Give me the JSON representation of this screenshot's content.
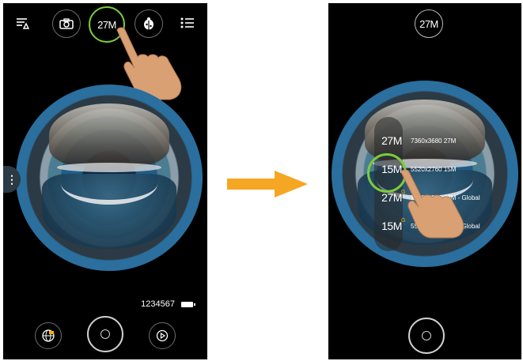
{
  "left_screen": {
    "top_icons": [
      {
        "name": "filter-menu-icon",
        "label": ""
      },
      {
        "name": "camera-icon",
        "label": ""
      },
      {
        "name": "resolution-selector",
        "label": "27M"
      },
      {
        "name": "ladybug-icon",
        "label": ""
      },
      {
        "name": "list-menu-icon",
        "label": ""
      }
    ],
    "resolution_label": "27M",
    "side_handle_glyph": "⋮",
    "status": {
      "counter": "1234567"
    },
    "bottom": {
      "mode_icon": "globe-icon",
      "play_icon": "play-icon"
    }
  },
  "right_screen": {
    "resolution_label": "27M",
    "menu": [
      {
        "badge": "27M",
        "suffix": "",
        "desc": "7360x3680 27M"
      },
      {
        "badge": "15M",
        "suffix": "",
        "desc": "5520x2760 15M"
      },
      {
        "badge": "27M",
        "suffix": "G",
        "desc": "7360x3680 27M - Global"
      },
      {
        "badge": "15M",
        "suffix": "G",
        "desc": "5520x2760 15M - Global"
      }
    ]
  },
  "colors": {
    "highlight_ring": "#7ccb3e",
    "arrow": "#f5a623",
    "hand": "#d9a074"
  }
}
